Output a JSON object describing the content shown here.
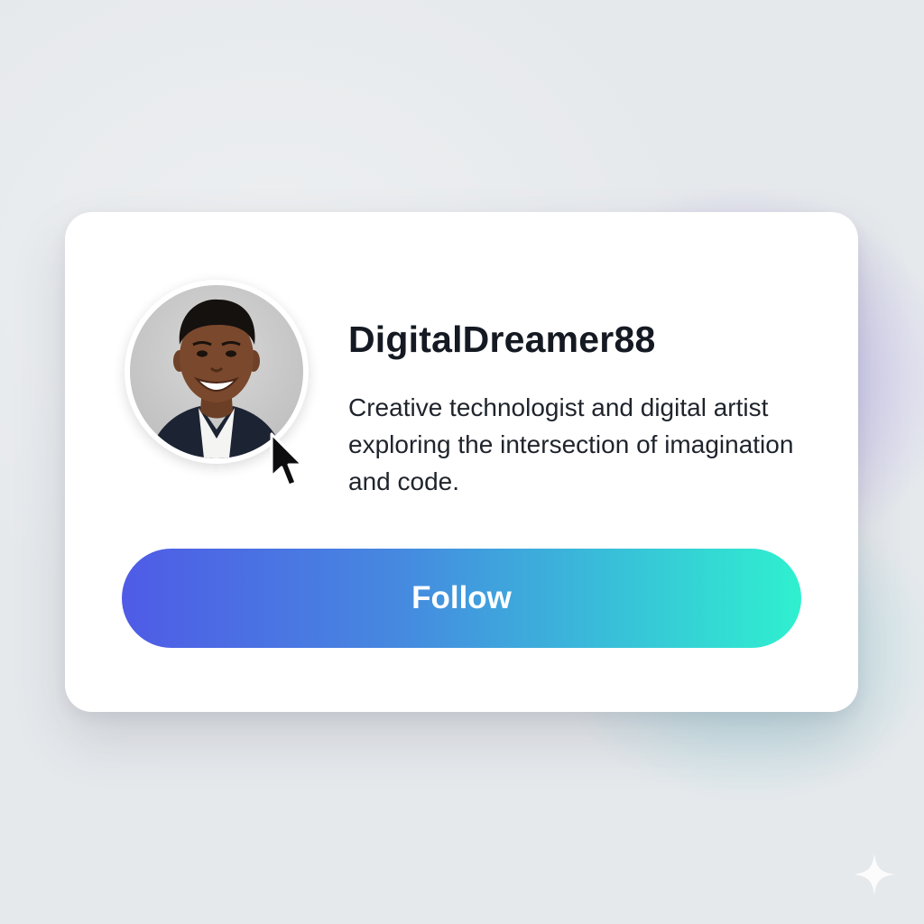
{
  "profile": {
    "username": "DigitalDreamer88",
    "bio": "Creative technologist and digital artist exploring the intersection of imagination and code.",
    "avatar_icon": "profile-photo"
  },
  "actions": {
    "follow_label": "Follow"
  },
  "icons": {
    "cursor": "mouse-pointer-icon",
    "corner": "sparkle-icon"
  },
  "colors": {
    "background": "#e6e9ec",
    "card": "#ffffff",
    "text_primary": "#141922",
    "button_gradient_start": "#4f5be6",
    "button_gradient_end": "#2ff0cf"
  }
}
